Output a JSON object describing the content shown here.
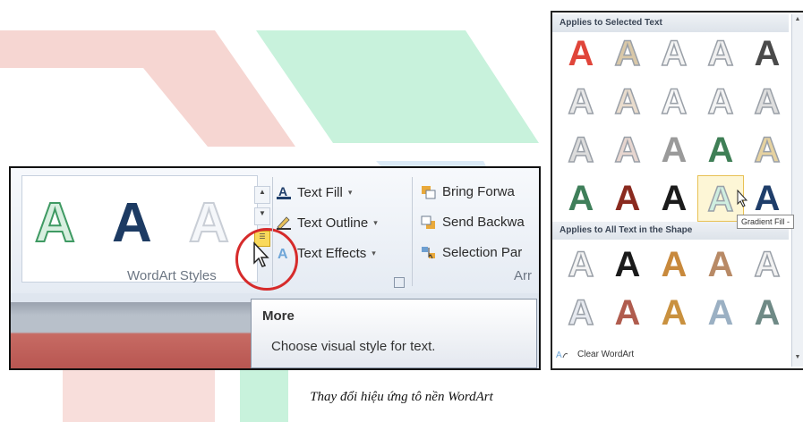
{
  "ribbon": {
    "gallery_letters": [
      "A",
      "A",
      "A"
    ],
    "group_label": "WordArt Styles",
    "text_fill_label": "Text Fill",
    "text_outline_label": "Text Outline",
    "text_effects_label": "Text Effects",
    "bring_forward_label": "Bring Forwa",
    "send_backward_label": "Send Backwa",
    "selection_pane_label": "Selection Par",
    "arrange_label": "Arr",
    "dropdown_arrow": "▾",
    "scroll_up": "▲",
    "scroll_down": "▼",
    "more_button": "☰"
  },
  "tooltip": {
    "title": "More",
    "body": "Choose visual style for text."
  },
  "gallery": {
    "section1": "Applies to Selected Text",
    "section2": "Applies to All Text in the Shape",
    "hover_tooltip": "Gradient Fill -",
    "clear_label": "Clear WordArt",
    "glyph": "A",
    "selected_cell": "Gradient Fill -",
    "rows_section1": [
      [
        "#e0453a",
        "#d9c8a8",
        "#f4f4f4",
        "#f0f0f0",
        "#4a4a4a"
      ],
      [
        "#e8e8e8",
        "#e9dccd",
        "#f7f7f7",
        "#f3f3f3",
        "#dedede"
      ],
      [
        "#dcdcdc",
        "#e7d6d0",
        "#9a9a9a",
        "#3f7f56",
        "#e6d2a0"
      ],
      [
        "#3f7f5a",
        "#8a2a1f",
        "#1b1b1b",
        "#cfeee0",
        "#1f3e6a"
      ]
    ],
    "rows_section2": [
      [
        "#f4f4f4",
        "#1a1a1a",
        "#c8893c",
        "#b88a66",
        "#f2f2f2"
      ],
      [
        "#e7eaf0",
        "#b05c4e",
        "#c9913f",
        "#9bb0c3",
        "#6f8a86"
      ]
    ]
  },
  "caption": "Thay đổi hiệu ứng tô nền WordArt",
  "watermark": {
    "green": "#c8f2dc",
    "red": "#f6d6d2",
    "blue": "#dbeaf7"
  }
}
